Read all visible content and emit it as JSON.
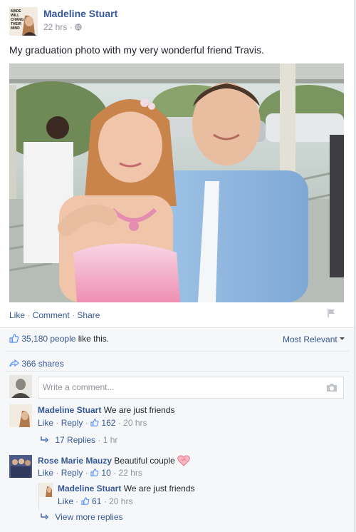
{
  "post": {
    "author": "Madeline Stuart",
    "avatar_text": [
      "MADE",
      "WILL",
      "CHANG",
      "THEIR",
      "MIND"
    ],
    "time": "22 hrs",
    "privacy_icon": "globe-icon",
    "text": "My graduation photo with my very wonderful friend Travis."
  },
  "actions": {
    "like": "Like",
    "comment": "Comment",
    "share": "Share"
  },
  "summary": {
    "likes_count": "35,180 people",
    "likes_suffix": " like this.",
    "sort": "Most Relevant",
    "shares": "366 shares"
  },
  "comment_input": {
    "placeholder": "Write a comment..."
  },
  "comments": [
    {
      "author": "Madeline Stuart",
      "text": "We are just friends",
      "like": "Like",
      "reply": "Reply",
      "likes": "162",
      "time": "20 hrs",
      "replies_link": "17 Replies",
      "replies_time": "1 hr"
    },
    {
      "author": "Rose Marie Mauzy",
      "text": "Beautiful couple",
      "like": "Like",
      "reply": {
        "author": "Madeline Stuart",
        "text": "We are just friends",
        "like": "Like",
        "likes": "61",
        "time": "20 hrs"
      },
      "likes": "10",
      "time": "22 hrs",
      "reply_label": "Reply",
      "view_more": "View more replies"
    }
  ],
  "colors": {
    "link": "#365899",
    "muted": "#90949c",
    "footer_bg": "#f6f7f9",
    "text": "#1d2129"
  }
}
